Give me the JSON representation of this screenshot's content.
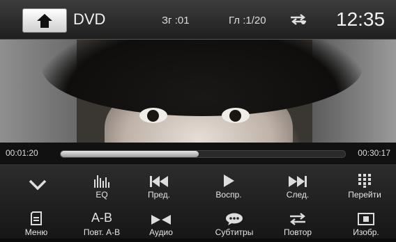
{
  "header": {
    "source": "DVD",
    "chapter": "Зг :01",
    "title_no": "Гл :1/20",
    "clock": "12:35"
  },
  "icons": {
    "home": "home-icon",
    "repeat": "repeat-icon"
  },
  "progress": {
    "elapsed": "00:01:20",
    "total": "00:30:17",
    "fraction": 0.485
  },
  "controls": {
    "row1": [
      {
        "label": "",
        "icon": "chevron-down-icon"
      },
      {
        "label": "EQ",
        "icon": "equalizer-icon"
      },
      {
        "label": "Пред.",
        "icon": "previous-icon"
      },
      {
        "label": "Воспр.",
        "icon": "play-icon"
      },
      {
        "label": "След.",
        "icon": "next-icon"
      },
      {
        "label": "Перейти",
        "icon": "keypad-icon"
      }
    ],
    "row2": [
      {
        "label": "Меню",
        "icon": "menu-icon"
      },
      {
        "label": "Повт. А-В",
        "icon": "ab-repeat-icon",
        "glyph": "A-B"
      },
      {
        "label": "Аудио",
        "icon": "audio-icon"
      },
      {
        "label": "Субтитры",
        "icon": "subtitles-icon"
      },
      {
        "label": "Повтор",
        "icon": "repeat-icon"
      },
      {
        "label": "Изобр.",
        "icon": "picture-icon"
      }
    ]
  }
}
